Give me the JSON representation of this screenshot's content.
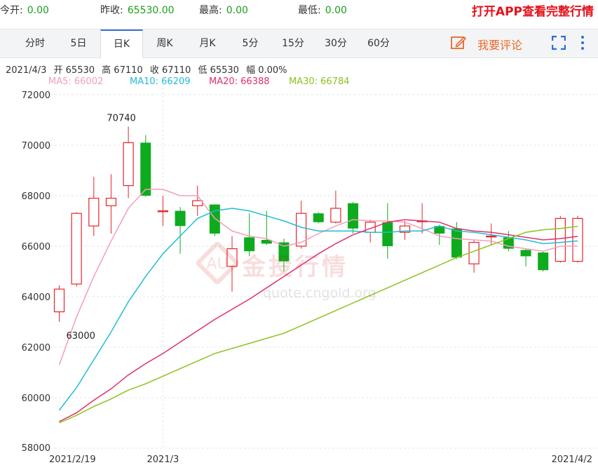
{
  "stats": [
    {
      "label": "今开:",
      "value": "0.00"
    },
    {
      "label": "昨收:",
      "value": "65530.00"
    },
    {
      "label": "最高:",
      "value": "0.00"
    },
    {
      "label": "最低:",
      "value": "0.00"
    }
  ],
  "promo": "打开APP查看完整行情",
  "tabs": [
    "分时",
    "5日",
    "日K",
    "周K",
    "月K",
    "5分",
    "15分",
    "30分",
    "60分"
  ],
  "active_tab": "日K",
  "comment_label": "我要评论",
  "icons": {
    "comment": "edit-pen-icon",
    "fullscreen": "fullscreen-icon",
    "more": "more-vertical-icon"
  },
  "info": {
    "date": "2021/4/3",
    "open": "开 65530",
    "high": "高 67110",
    "close": "收 67110",
    "low": "低 65530",
    "change": "幅 0.00%"
  },
  "ma_legend": [
    {
      "label": "MA5: 66002",
      "color": "#f59dbc"
    },
    {
      "label": "MA10: 66209",
      "color": "#22bcd4"
    },
    {
      "label": "MA20: 66388",
      "color": "#e0306a"
    },
    {
      "label": "MA30: 66784",
      "color": "#8ec21e"
    }
  ],
  "watermark": {
    "brand": "金投行情",
    "site": "quote.cngold.org"
  },
  "colors": {
    "up": "#e5262b",
    "down": "#0eab1e",
    "stat_value": "#18a018",
    "promo": "#e5101a"
  },
  "chart_data": {
    "type": "candlestick",
    "ylim": [
      58000,
      72000
    ],
    "yticks": [
      58000,
      60000,
      62000,
      64000,
      66000,
      68000,
      70000,
      72000
    ],
    "xlabels": [
      {
        "index": 0,
        "label": "2021/2/19"
      },
      {
        "index": 6,
        "label": "2021/3"
      },
      {
        "index": 30,
        "label": "2021/4/2"
      }
    ],
    "annotations": [
      {
        "index": 4,
        "value": 70740,
        "text": "70740",
        "pos": "above"
      },
      {
        "index": 0,
        "value": 63000,
        "text": "63000",
        "pos": "below"
      }
    ],
    "grid": "horizontal dashed + vertical dashed at month start",
    "candles": [
      {
        "date": "2021/2/19",
        "o": 63400,
        "c": 64300,
        "h": 64450,
        "l": 63000
      },
      {
        "date": "2021/2/22",
        "o": 64500,
        "c": 67300,
        "h": 67350,
        "l": 64400
      },
      {
        "date": "2021/2/23",
        "o": 66800,
        "c": 67900,
        "h": 68750,
        "l": 66400
      },
      {
        "date": "2021/2/24",
        "o": 67600,
        "c": 67900,
        "h": 68850,
        "l": 66500
      },
      {
        "date": "2021/2/25",
        "o": 68400,
        "c": 70100,
        "h": 70740,
        "l": 67900
      },
      {
        "date": "2021/2/26",
        "o": 70100,
        "c": 68000,
        "h": 70400,
        "l": 67950
      },
      {
        "date": "2021/3/1",
        "o": 67400,
        "c": 67400,
        "h": 68000,
        "l": 66800
      },
      {
        "date": "2021/3/2",
        "o": 67400,
        "c": 66800,
        "h": 67550,
        "l": 65700
      },
      {
        "date": "2021/3/3",
        "o": 67600,
        "c": 67800,
        "h": 68400,
        "l": 67200
      },
      {
        "date": "2021/3/4",
        "o": 67650,
        "c": 66500,
        "h": 67650,
        "l": 66400
      },
      {
        "date": "2021/3/5",
        "o": 65200,
        "c": 65900,
        "h": 66400,
        "l": 64200
      },
      {
        "date": "2021/3/8",
        "o": 66350,
        "c": 65800,
        "h": 67300,
        "l": 65600
      },
      {
        "date": "2021/3/9",
        "o": 66250,
        "c": 66100,
        "h": 67400,
        "l": 66050
      },
      {
        "date": "2021/3/10",
        "o": 66150,
        "c": 65400,
        "h": 66300,
        "l": 65000
      },
      {
        "date": "2021/3/11",
        "o": 66000,
        "c": 67300,
        "h": 67800,
        "l": 65900
      },
      {
        "date": "2021/3/12",
        "o": 67300,
        "c": 66950,
        "h": 67350,
        "l": 66900
      },
      {
        "date": "2021/3/15",
        "o": 66950,
        "c": 67500,
        "h": 68200,
        "l": 66900
      },
      {
        "date": "2021/3/16",
        "o": 67700,
        "c": 66700,
        "h": 67750,
        "l": 66500
      },
      {
        "date": "2021/3/17",
        "o": 66550,
        "c": 66950,
        "h": 67050,
        "l": 66150
      },
      {
        "date": "2021/3/18",
        "o": 66950,
        "c": 66000,
        "h": 67700,
        "l": 65500
      },
      {
        "date": "2021/3/19",
        "o": 66550,
        "c": 66800,
        "h": 67000,
        "l": 66250
      },
      {
        "date": "2021/3/22",
        "o": 67000,
        "c": 67000,
        "h": 67700,
        "l": 66500
      },
      {
        "date": "2021/3/23",
        "o": 66800,
        "c": 66500,
        "h": 66850,
        "l": 66050
      },
      {
        "date": "2021/3/24",
        "o": 66700,
        "c": 65550,
        "h": 66950,
        "l": 65500
      },
      {
        "date": "2021/3/25",
        "o": 65300,
        "c": 66150,
        "h": 66250,
        "l": 64950
      },
      {
        "date": "2021/3/26",
        "o": 66400,
        "c": 66400,
        "h": 66900,
        "l": 66050
      },
      {
        "date": "2021/3/29",
        "o": 66350,
        "c": 65900,
        "h": 66600,
        "l": 65800
      },
      {
        "date": "2021/3/30",
        "o": 65850,
        "c": 65600,
        "h": 65900,
        "l": 65200
      },
      {
        "date": "2021/3/31",
        "o": 65750,
        "c": 65050,
        "h": 65800,
        "l": 65000
      },
      {
        "date": "2021/4/1",
        "o": 65400,
        "c": 67100,
        "h": 67200,
        "l": 65350
      },
      {
        "date": "2021/4/2",
        "o": 65400,
        "c": 67100,
        "h": 67200,
        "l": 65350
      }
    ],
    "series": [
      {
        "name": "MA5",
        "color": "#f59dbc",
        "values": [
          61300,
          63200,
          64800,
          66200,
          67500,
          68250,
          68250,
          68000,
          68000,
          67100,
          66600,
          66400,
          66300,
          66000,
          66150,
          66500,
          66800,
          67050,
          67000,
          67000,
          66950,
          66700,
          66400,
          66300,
          66250,
          66200,
          66000,
          65900,
          65800,
          66000,
          66000
        ]
      },
      {
        "name": "MA10",
        "color": "#22bcd4",
        "values": [
          59500,
          60400,
          61500,
          62600,
          63800,
          64800,
          65700,
          66400,
          67100,
          67400,
          67500,
          67400,
          67200,
          67000,
          66750,
          66600,
          66600,
          66600,
          66550,
          66550,
          66600,
          66600,
          66800,
          66600,
          66550,
          66450,
          66350,
          66250,
          66100,
          66150,
          66209
        ]
      },
      {
        "name": "MA20",
        "color": "#e0306a",
        "values": [
          59050,
          59400,
          59900,
          60350,
          60900,
          61350,
          61750,
          62200,
          62650,
          63100,
          63500,
          63900,
          64350,
          64800,
          65250,
          65700,
          66100,
          66450,
          66700,
          66950,
          67050,
          67000,
          66950,
          66700,
          66600,
          66550,
          66450,
          66350,
          66250,
          66300,
          66388
        ]
      },
      {
        "name": "MA30",
        "color": "#8ec21e",
        "values": [
          59000,
          59300,
          59650,
          59950,
          60300,
          60550,
          60850,
          61150,
          61450,
          61750,
          61950,
          62150,
          62350,
          62550,
          62850,
          63150,
          63450,
          63750,
          64050,
          64350,
          64650,
          64950,
          65250,
          65550,
          65800,
          66050,
          66300,
          66550,
          66650,
          66700,
          66784
        ]
      }
    ]
  }
}
